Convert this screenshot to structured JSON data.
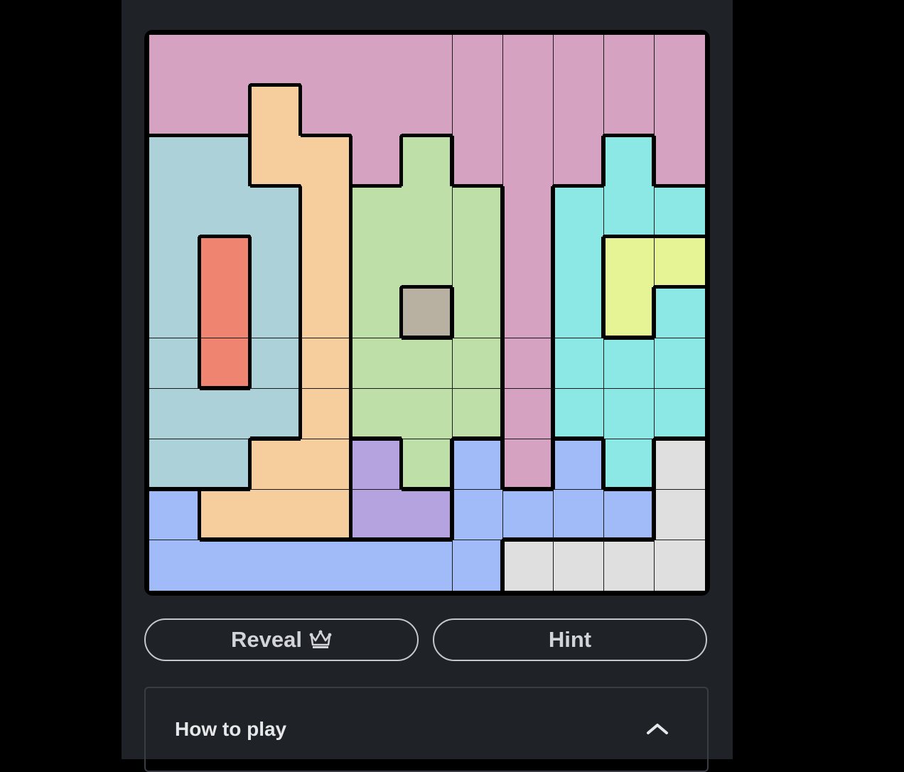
{
  "colors": {
    "pink": "#d5a3c1",
    "peach": "#f6cd9d",
    "lightblue": "#acd1d8",
    "green": "#bedfa7",
    "cyan": "#8be8e5",
    "orange": "#ef8570",
    "yellow": "#e6f496",
    "taupe": "#b8b1a1",
    "purple": "#b4a3df",
    "blue": "#a1baf8",
    "grey": "#dfdfdf"
  },
  "board": {
    "size": 11,
    "rows": [
      "PPPPPPPPPPP",
      "PPEPPPPPPPP",
      "LLEEPGPPPCP",
      "LLLEGGGPCCC",
      "LOLEGGGPCYY",
      "LOLEGTGPCYC",
      "LOLEGGGPCCC",
      "LLLEGGGPCCC",
      "LLEEUGBPBCW",
      "BEEEUUBBBBW",
      "BBBBBBBWWWW"
    ],
    "legend": {
      "P": "pink",
      "E": "peach",
      "L": "lightblue",
      "G": "green",
      "C": "cyan",
      "O": "orange",
      "Y": "yellow",
      "T": "taupe",
      "U": "purple",
      "B": "blue",
      "W": "grey"
    }
  },
  "buttons": {
    "reveal_label": "Reveal",
    "reveal_icon": "crown-icon",
    "hint_label": "Hint"
  },
  "how_to_play": {
    "title": "How to play",
    "toggle_icon": "chevron-up-icon"
  }
}
